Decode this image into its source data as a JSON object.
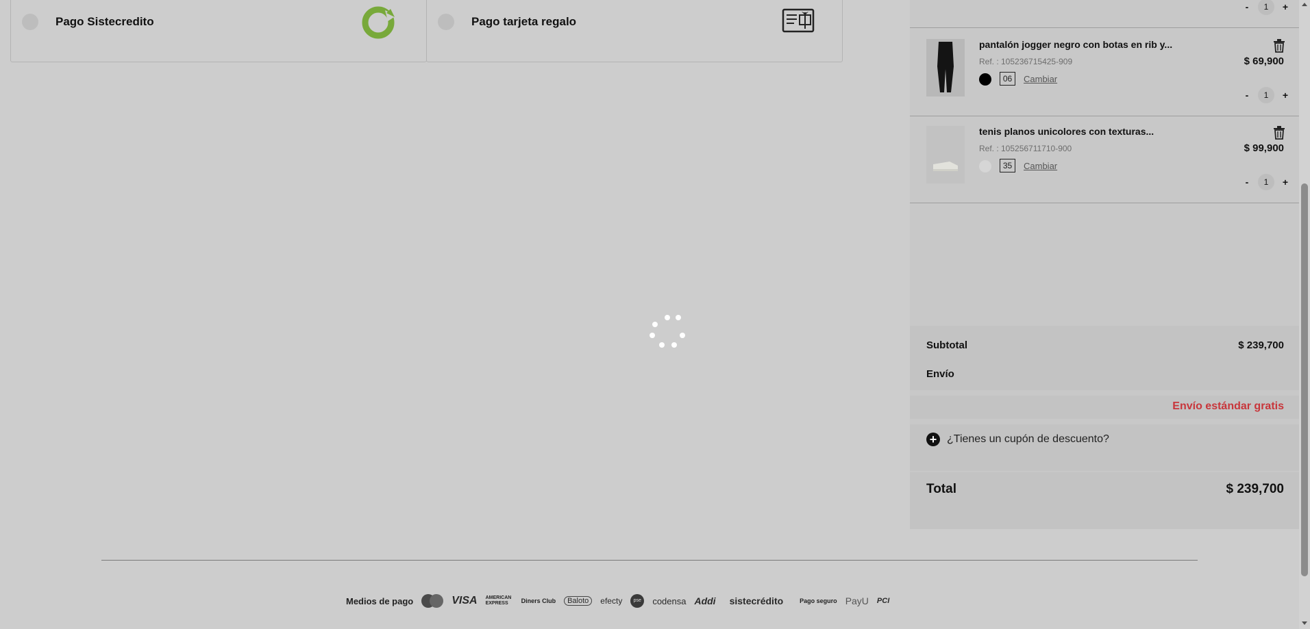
{
  "payment_options": [
    {
      "label": "Pago Sistecredito",
      "icon": "sistecredito-logo-icon",
      "accent": "#78a93a"
    },
    {
      "label": "Pago tarjeta regalo",
      "icon": "gift-card-icon"
    }
  ],
  "loading": {
    "icon": "spinner-icon"
  },
  "cart": {
    "items": [
      {
        "name": "pantalón jogger negro con botas en rib y...",
        "ref": "Ref. : 105236715425-909",
        "color": "#000000",
        "size": "06",
        "change_label": "Cambiar",
        "price": "$ 69,900",
        "qty": "1",
        "minus": "-",
        "plus": "+"
      },
      {
        "name": "tenis planos unicolores con texturas...",
        "ref": "Ref. : 105256711710-900",
        "color": "#d6d6d6",
        "size": "35",
        "change_label": "Cambiar",
        "price": "$ 99,900",
        "qty": "1",
        "minus": "-",
        "plus": "+"
      }
    ],
    "top_item_qty": {
      "minus": "-",
      "qty": "1",
      "plus": "+"
    },
    "subtotal_label": "Subtotal",
    "subtotal_value": "$ 239,700",
    "shipping_label": "Envío",
    "shipping_value": "Envío estándar gratis",
    "shipping_color": "#c8363b",
    "coupon_label": "¿Tienes un cupón de descuento?",
    "coupon_icon": "plus-circle-icon",
    "total_label": "Total",
    "total_value": "$ 239,700"
  },
  "footer": {
    "payment_methods_label": "Medios de pago",
    "logos": [
      "VISA",
      "AMERICAN EXPRESS",
      "Diners Club",
      "Baloto",
      "efecty",
      "pse",
      "codensa",
      "Addi",
      "sistecrédito"
    ],
    "secure_label": "Pago seguro",
    "secure_logos": [
      "PayU",
      "PCI"
    ]
  }
}
